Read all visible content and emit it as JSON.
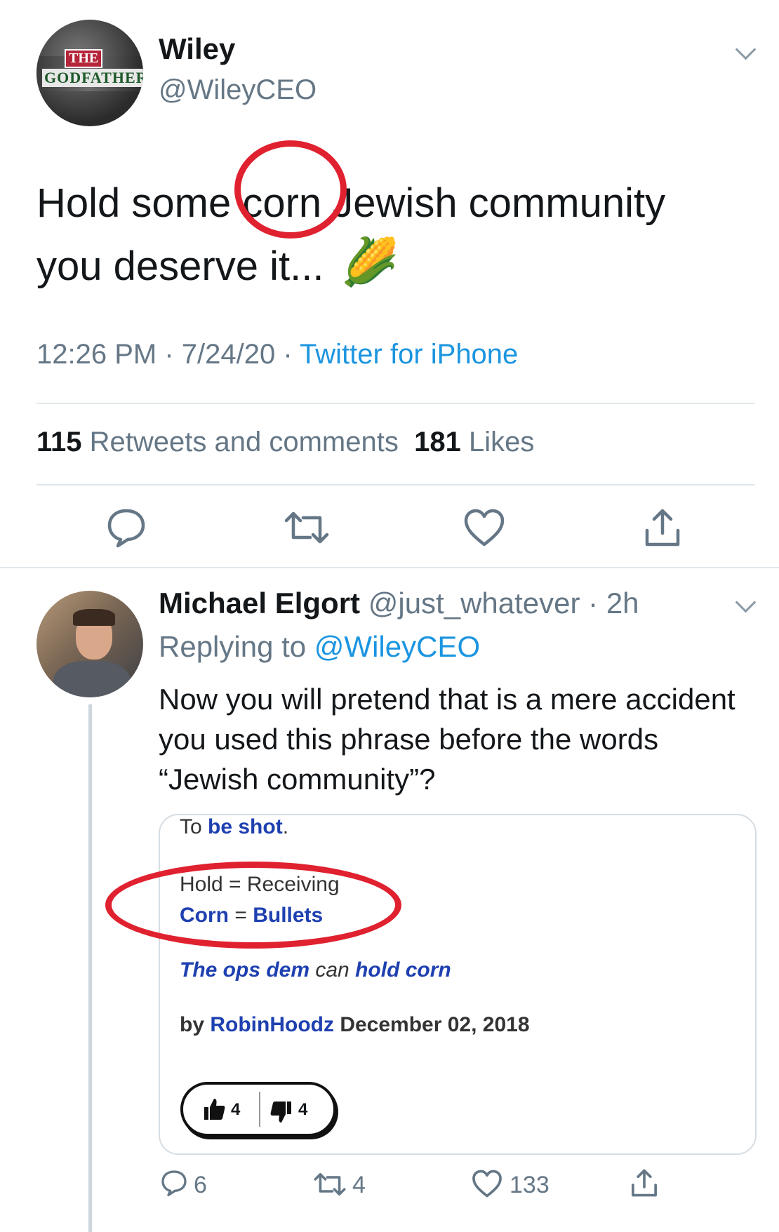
{
  "main_tweet": {
    "author_name": "Wiley",
    "author_handle": "@WileyCEO",
    "avatar_text": [
      "THE",
      "GODFATHER"
    ],
    "text_line1_before": "Hold some ",
    "text_highlight": "corn",
    "text_line1_after": " Jewish community",
    "text_line2": "you deserve it...",
    "emoji": "🌽",
    "time": "12:26 PM · 7/24/20 · ",
    "source": "Twitter for iPhone",
    "retweets_count": "115",
    "retweets_label": " Retweets and comments  ",
    "likes_count": "181",
    "likes_label": " Likes"
  },
  "reply": {
    "author_name": "Michael Elgort",
    "author_meta": " @just_whatever · 2h",
    "replying_prefix": "Replying to ",
    "replying_handle": "@WileyCEO",
    "text": "Now you will pretend that is a mere accident you used this phrase before the words “Jewish community”?",
    "card": {
      "line1_prefix": "To ",
      "line1_bold": "be shot",
      "line1_suffix": ".",
      "hold_line": "Hold = Receiving",
      "corn_word": "Corn",
      "corn_eq": " = ",
      "corn_meaning": "Bullets",
      "example_1": "The ops dem",
      "example_2": " can ",
      "example_3": "hold corn",
      "by": "by ",
      "author": "RobinHoodz",
      "date": " December 02, 2018",
      "up_count": "4",
      "down_count": "4"
    },
    "actions": {
      "replies": "6",
      "retweets": "4",
      "likes": "133"
    }
  },
  "colors": {
    "accent": "#1b95e0",
    "muted": "#657786",
    "annotation_red": "#e0212f",
    "card_blue": "#1e40b0"
  }
}
